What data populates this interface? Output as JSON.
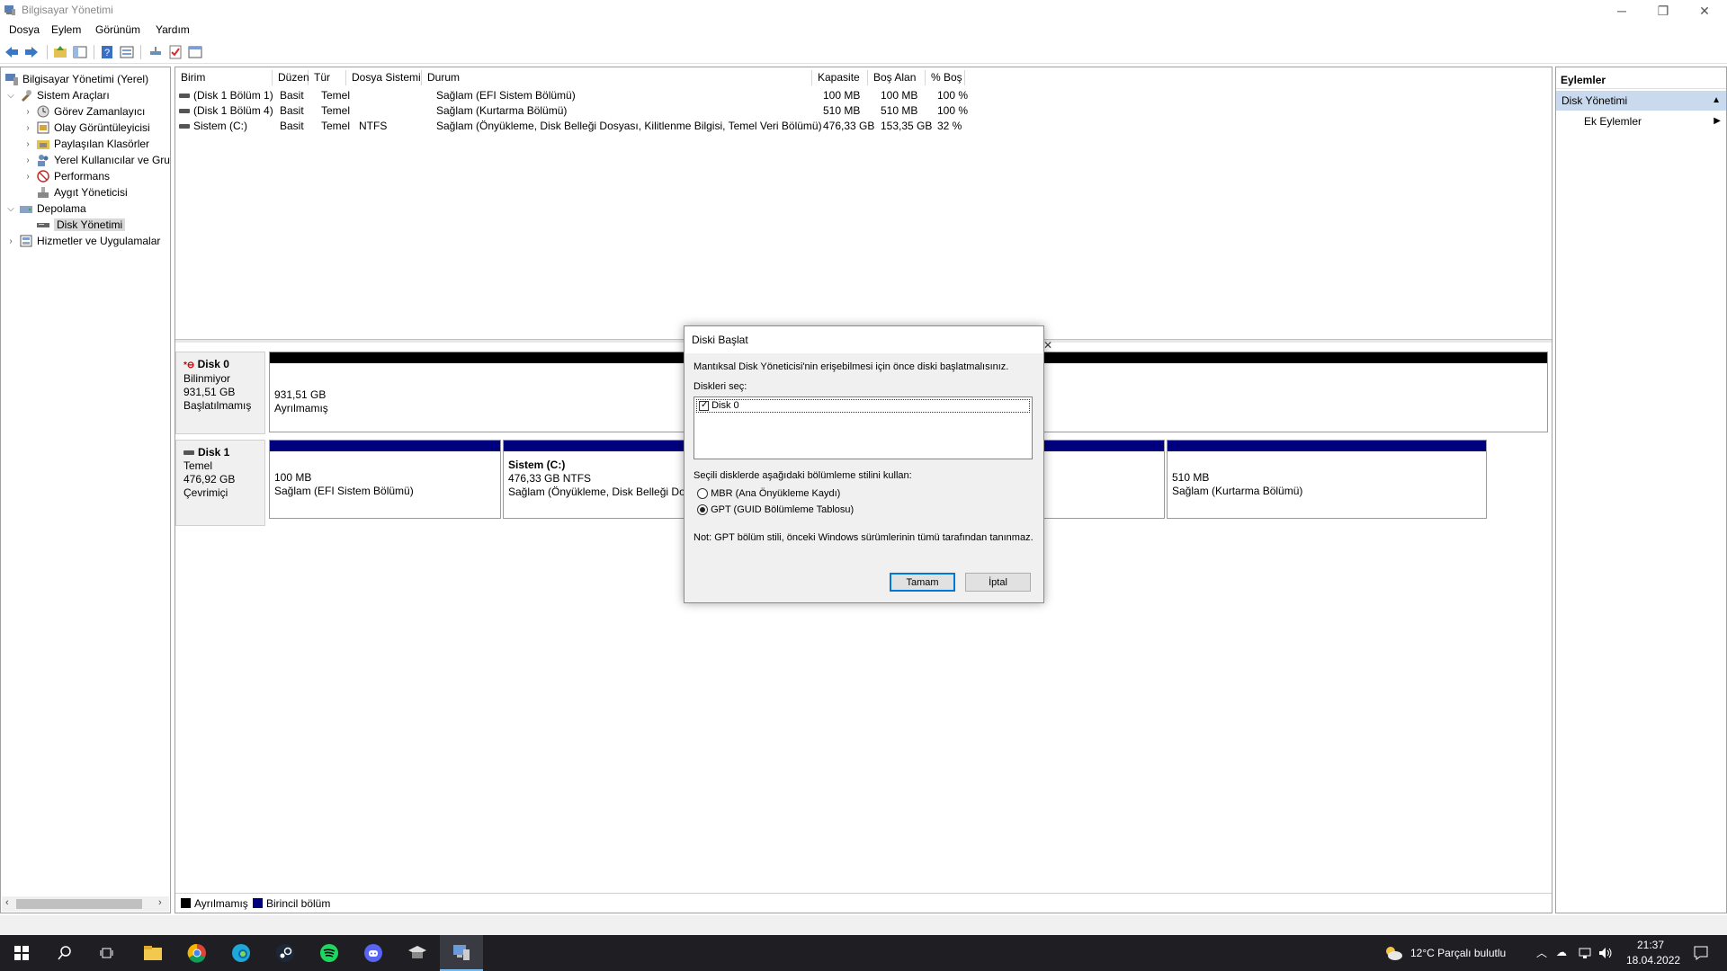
{
  "window": {
    "title": "Bilgisayar Yönetimi"
  },
  "menu": [
    "Dosya",
    "Eylem",
    "Görünüm",
    "Yardım"
  ],
  "tree": {
    "root": "Bilgisayar Yönetimi (Yerel)",
    "system_tools": "Sistem Araçları",
    "task_scheduler": "Görev Zamanlayıcı",
    "event_viewer": "Olay Görüntüleyicisi",
    "shared_folders": "Paylaşılan Klasörler",
    "local_users": "Yerel Kullanıcılar ve Gru",
    "performance": "Performans",
    "device_manager": "Aygıt Yöneticisi",
    "storage": "Depolama",
    "disk_management": "Disk Yönetimi",
    "services": "Hizmetler ve Uygulamalar"
  },
  "grid": {
    "headers": [
      "Birim",
      "Düzen",
      "Tür",
      "Dosya Sistemi",
      "Durum",
      "Kapasite",
      "Boş Alan",
      "% Boş"
    ],
    "rows": [
      [
        "(Disk 1 Bölüm 1)",
        "Basit",
        "Temel",
        "",
        "Sağlam (EFI Sistem Bölümü)",
        "100 MB",
        "100 MB",
        "100 %"
      ],
      [
        "(Disk 1 Bölüm 4)",
        "Basit",
        "Temel",
        "",
        "Sağlam (Kurtarma Bölümü)",
        "510 MB",
        "510 MB",
        "100 %"
      ],
      [
        "Sistem (C:)",
        "Basit",
        "Temel",
        "NTFS",
        "Sağlam (Önyükleme, Disk Belleği Dosyası, Kilitlenme Bilgisi, Temel Veri Bölümü)",
        "476,33 GB",
        "153,35 GB",
        "32 %"
      ]
    ]
  },
  "disks": {
    "disk0": {
      "name": "Disk 0",
      "type": "Bilinmiyor",
      "size": "931,51 GB",
      "status": "Başlatılmamış",
      "part_size": "931,51 GB",
      "part_status": "Ayrılmamış"
    },
    "disk1": {
      "name": "Disk 1",
      "type": "Temel",
      "size": "476,92 GB",
      "status": "Çevrimiçi",
      "p1_size": "100 MB",
      "p1_status": "Sağlam (EFI Sistem Bölümü)",
      "p2_name": "Sistem  (C:)",
      "p2_size": "476,33 GB NTFS",
      "p2_status": "Sağlam (Önyükleme, Disk Belleği Dos",
      "p3_size": "510 MB",
      "p3_status": "Sağlam (Kurtarma Bölümü)"
    }
  },
  "legend": {
    "unallocated": "Ayrılmamış",
    "primary": "Birincil bölüm"
  },
  "actions": {
    "header": "Eylemler",
    "section": "Disk Yönetimi",
    "more": "Ek Eylemler"
  },
  "dialog": {
    "title": "Diski Başlat",
    "intro": "Mantıksal Disk Yöneticisi'nin erişebilmesi için önce diski başlatmalısınız.",
    "select_label": "Diskleri seç:",
    "disk_item": "Disk 0",
    "style_label": "Seçili disklerde aşağıdaki bölümleme stilini kullan:",
    "mbr": "MBR (Ana Önyükleme Kaydı)",
    "gpt": "GPT (GUID Bölümleme Tablosu)",
    "note": "Not: GPT bölüm stili, önceki Windows sürümlerinin tümü tarafından tanınmaz.",
    "ok": "Tamam",
    "cancel": "İptal"
  },
  "tray": {
    "weather": "12°C  Parçalı bulutlu",
    "time": "21:37",
    "date": "18.04.2022"
  },
  "colors": {
    "unallocated": "#000000",
    "primary": "#00007f",
    "taskbar": "#1f1f23",
    "accent": "#0078d7"
  }
}
